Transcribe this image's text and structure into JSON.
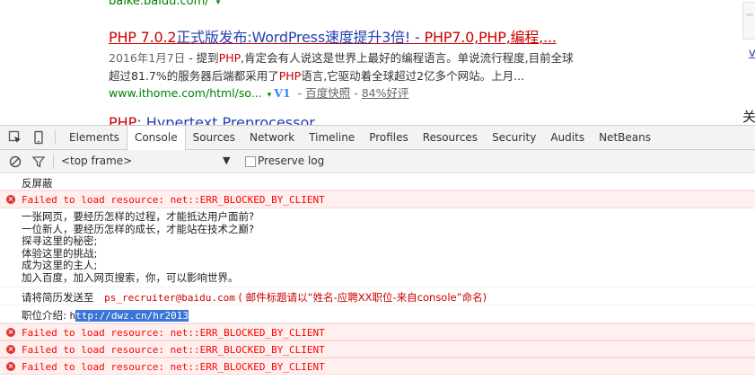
{
  "search_page": {
    "prev_url": "baike.baidu.com/",
    "prev_url_arrow": "▾",
    "result": {
      "title_prefix": "PHP 7.0.2",
      "title_middle": "正式版发布:WordPress速度提升3倍! - ",
      "title_suffix": "PHP7.0,PHP,编程,...",
      "date": "2016年1月7日",
      "snippet1_a": " - 提到",
      "snippet1_hl": "PHP",
      "snippet1_b": ",肯定会有人说这是世界上最好的编程语言。单说流行程度,目前全球",
      "snippet2_a": "超过81.7%的服务器后端都采用了",
      "snippet2_hl": "PHP",
      "snippet2_b": "语言,它驱动着全球超过2亿多个网站。上月...",
      "url": "www.ithome.com/html/so...",
      "url_arrow": "▾",
      "v1_badge": "V1",
      "cache_link": "百度快照",
      "rating_link": "84%好评"
    },
    "next_title_hl": "PHP",
    "next_title_rest": ": Hypertext Preprocessor",
    "right_v": "v",
    "right_guan": "关"
  },
  "devtools": {
    "tabs": [
      "Elements",
      "Console",
      "Sources",
      "Network",
      "Timeline",
      "Profiles",
      "Resources",
      "Security",
      "Audits",
      "NetBeans"
    ],
    "active_tab": "Console",
    "frame_selector": "<top frame>",
    "frame_dropdown_arrow": "▼",
    "preserve_log_label": "Preserve log",
    "preserve_log_checked": false
  },
  "console": {
    "line1": "反屏蔽",
    "error_text": "Failed to load resource: net::ERR_BLOCKED_BY_CLIENT",
    "poem": [
      "一张网页，要经历怎样的过程，才能抵达用户面前?",
      "一位新人，要经历怎样的成长，才能站在技术之巅?",
      "探寻这里的秘密;",
      "体验这里的挑战;",
      "成为这里的主人;",
      "加入百度，加入网页搜索，你，可以影响世界。"
    ],
    "resume_label": "请将简历发送至",
    "resume_email": "ps_recruiter@baidu.com",
    "resume_note": "( 邮件标题请以“姓名-应聘XX职位-来自console”命名)",
    "job_label": "职位介绍:",
    "job_link_first": "h",
    "job_link_rest": "ttp://dwz.cn/hr2013"
  },
  "colors": {
    "error_red": "#ff0000",
    "title_red": "#cc0000",
    "link_blue": "#2440b3",
    "url_green": "#008000",
    "selection_blue": "#3875d7"
  }
}
